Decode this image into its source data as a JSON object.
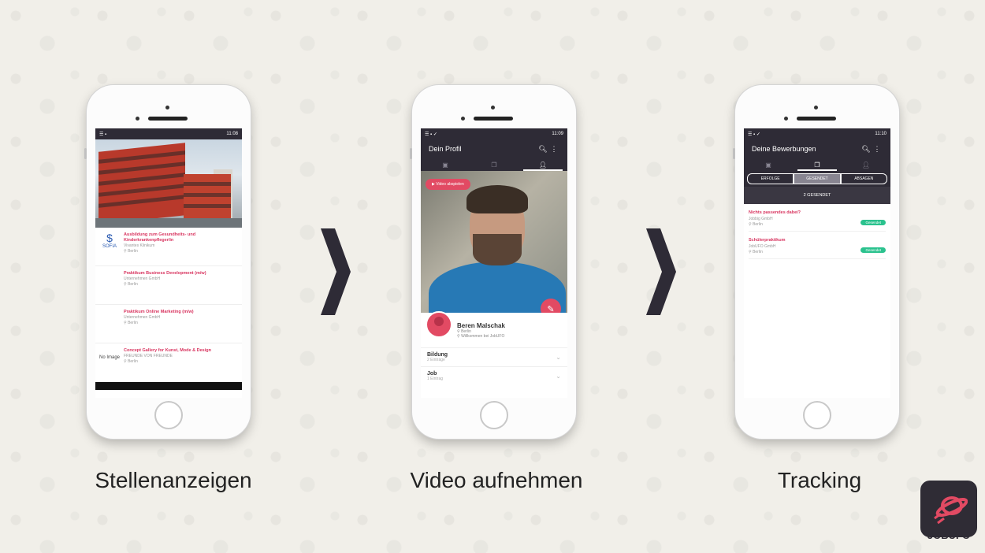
{
  "phone1": {
    "time": "11:08",
    "jobs": [
      {
        "title": "Ausbildung zum Gesundheits- und Kinderkrankenpfleger/in",
        "company": "Vivantes Klinikum",
        "location": "Berlin",
        "logo": "SOFIA"
      },
      {
        "title": "Praktikum Business Development (m/w)",
        "company": "Unternehmen GmbH",
        "location": "Berlin",
        "logo": ""
      },
      {
        "title": "Praktikum Online Marketing (m/w)",
        "company": "Unternehmen GmbH",
        "location": "Berlin",
        "logo": ""
      },
      {
        "title": "Concept Gallery for Kunst, Mode & Design",
        "company": "FREUNDE VON FREUNDE",
        "location": "Berlin",
        "logo": "No Image"
      }
    ]
  },
  "phone2": {
    "time": "11:09",
    "title": "Dein Profil",
    "video_button": "▶ Video abspielen",
    "name": "Beren Malschak",
    "location": "Berlin",
    "sub": "Willkommen bei JobUFO",
    "sections": [
      {
        "title": "Bildung",
        "count": "2 Einträge"
      },
      {
        "title": "Job",
        "count": "1 Eintrag"
      }
    ]
  },
  "phone3": {
    "time": "11:10",
    "title": "Deine Bewerbungen",
    "segments": [
      "ERFOLGE",
      "GESENDET",
      "ABSAGEN"
    ],
    "count_label": "2 GESENDET",
    "applications": [
      {
        "title": "Nichts passendes dabei?",
        "company": "Jobbig GmbH",
        "location": "Berlin",
        "status": "Gesendet"
      },
      {
        "title": "Schülerpraktikum",
        "company": "JobUFO GmbH",
        "location": "Berlin",
        "status": "Gesendet"
      }
    ]
  },
  "captions": [
    "Stellenanzeigen",
    "Video aufnehmen",
    "Tracking"
  ],
  "brand": {
    "name": "JOBUFO",
    "color": "#e24a63",
    "dark": "#2e2b36"
  }
}
